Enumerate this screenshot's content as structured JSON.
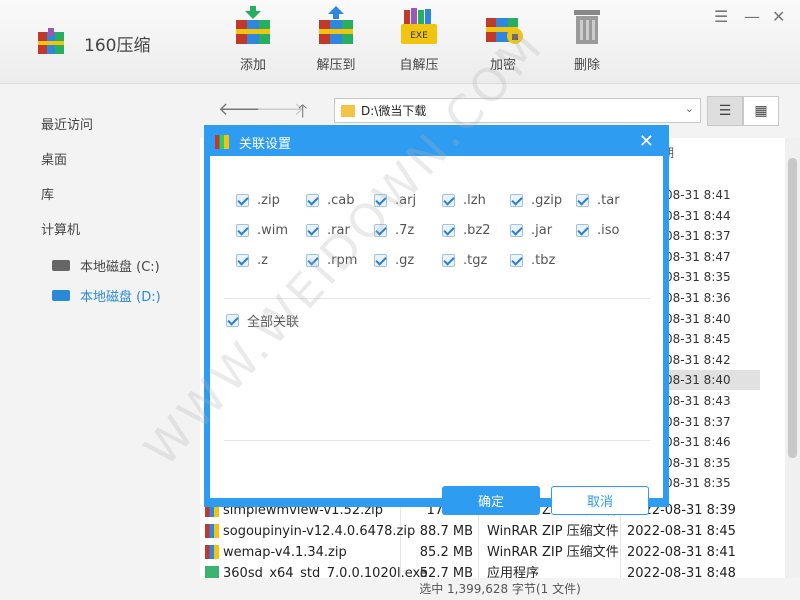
{
  "app": {
    "name": "160压缩"
  },
  "toolbar": [
    {
      "label": "添加",
      "icon": "add-archive-icon"
    },
    {
      "label": "解压到",
      "icon": "extract-to-icon"
    },
    {
      "label": "自解压",
      "icon": "self-extract-exe-icon",
      "badge": "EXE"
    },
    {
      "label": "加密",
      "icon": "encrypt-lock-icon"
    },
    {
      "label": "删除",
      "icon": "trash-icon"
    }
  ],
  "window_controls": {
    "menu": "☰",
    "minimize": "—",
    "close": "✕"
  },
  "sidebar": {
    "items": [
      "最近访问",
      "桌面",
      "库",
      "计算机"
    ],
    "disks": [
      {
        "label": "本地磁盘 (C:)",
        "active": false
      },
      {
        "label": "本地磁盘 (D:)",
        "active": true
      }
    ]
  },
  "nav": {
    "path": "D:\\微当下载",
    "back": "🡐",
    "forward": "🡒",
    "up": "🡑"
  },
  "file_list": {
    "header_fragment": "期",
    "visible_dates": [
      "08-31 8:41",
      "08-31 8:44",
      "08-31 8:37",
      "08-31 8:47",
      "08-31 8:35",
      "08-31 8:36",
      "08-31 8:40",
      "08-31 8:45",
      "08-31 8:42",
      "08-31 8:40",
      "08-31 8:43",
      "08-31 8:37",
      "08-31 8:46",
      "08-31 8:35",
      "08-31 8:35"
    ],
    "selected_date_index": 9,
    "rows": [
      {
        "name": "simplewmview-v1.52.zip",
        "size": "175 KB",
        "type": "WinRAR ZIP 压缩文件",
        "date": "2022-08-31 8:39"
      },
      {
        "name": "sogoupinyin-v12.4.0.6478.zip",
        "size": "88.7 MB",
        "type": "WinRAR ZIP 压缩文件",
        "date": "2022-08-31 8:45"
      },
      {
        "name": "wemap-v4.1.34.zip",
        "size": "85.2 MB",
        "type": "WinRAR ZIP 压缩文件",
        "date": "2022-08-31 8:41"
      },
      {
        "name": "360sd_x64_std_7.0.0.1020l.exe",
        "size": "52.7 MB",
        "type": "应用程序",
        "date": "2022-08-31 8:48"
      }
    ]
  },
  "status": {
    "text": "选中 1,399,628 字节(1 文件)"
  },
  "dialog": {
    "title": "关联设置",
    "extensions": [
      ".zip",
      ".cab",
      ".arj",
      ".lzh",
      ".gzip",
      ".tar",
      ".wim",
      ".rar",
      ".7z",
      ".bz2",
      ".jar",
      ".iso",
      ".z",
      ".rpm",
      ".gz",
      ".tgz",
      ".tbz"
    ],
    "all_label": "全部关联",
    "confirm": "确定",
    "cancel": "取消",
    "close": "✕"
  },
  "watermark": "WWW.WEIDOWN.COM",
  "colors": {
    "accent": "#2e9cf0",
    "selected_row": "#e1e1e1"
  }
}
